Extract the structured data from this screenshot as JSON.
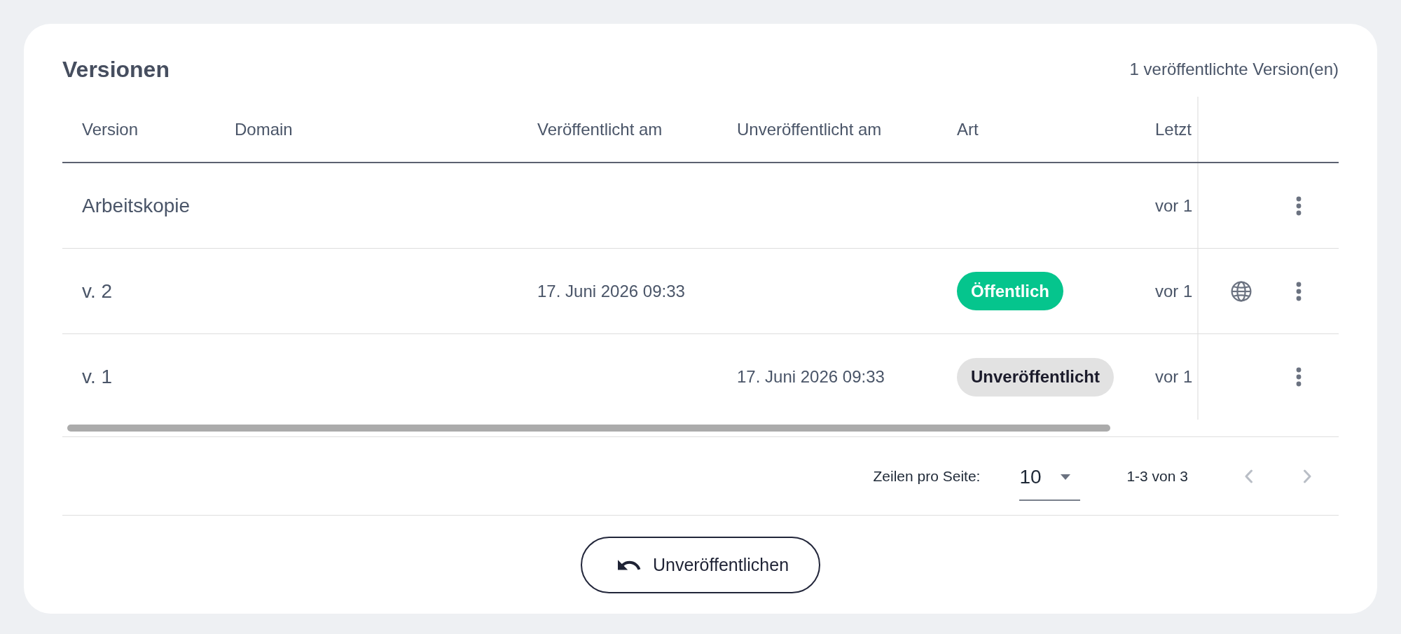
{
  "header": {
    "title": "Versionen",
    "summary": "1 veröffentlichte Version(en)"
  },
  "table": {
    "columns": [
      "Version",
      "Domain",
      "Veröffentlicht am",
      "Unveröffentlicht am",
      "Art",
      "Letzt"
    ],
    "rows": [
      {
        "version": "Arbeitskopie",
        "column_6": "vor 1",
        "online": false
      },
      {
        "version": "v. 2",
        "published_at": "17. Juni 2026 09:33",
        "status": {
          "label": "Öffentlich",
          "kind": "public"
        },
        "column_6": "vor 1",
        "online": true
      },
      {
        "version": "v. 1",
        "unpublished_at": "17. Juni 2026 09:33",
        "status": {
          "label": "Unveröffentlicht",
          "kind": "unpublished"
        },
        "column_6": "vor 1",
        "online": false
      }
    ]
  },
  "pagination": {
    "rows_per_page_label": "Zeilen pro Seite:",
    "rows_per_page": "10",
    "range": "1-3 von 3",
    "previous": {
      "disabled": true
    },
    "next": {
      "disabled": true
    }
  },
  "action_button": {
    "label": "Unveröffentlichen"
  }
}
